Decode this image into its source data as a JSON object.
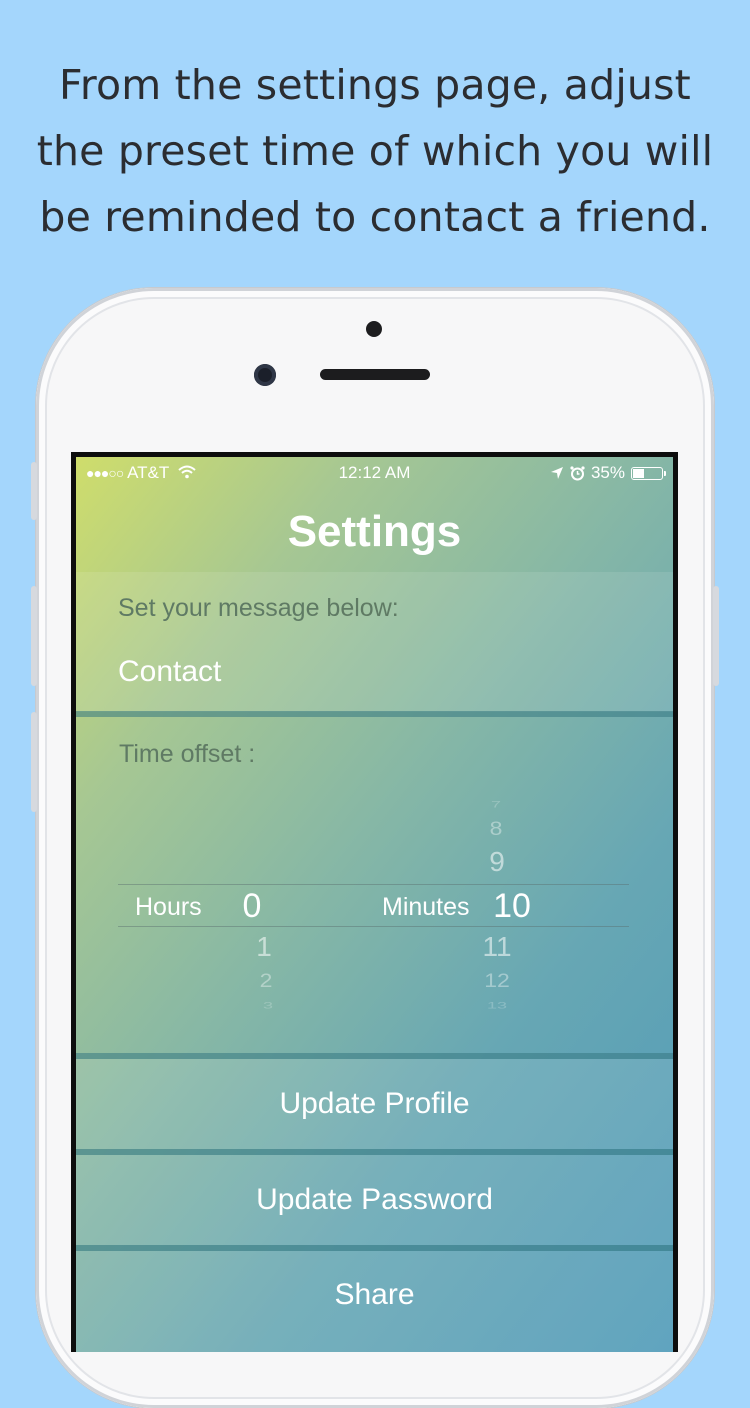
{
  "caption": {
    "line1": "From the settings page, adjust",
    "line2": "the preset time of which you will",
    "line3": "be reminded to contact a friend."
  },
  "status_bar": {
    "signal": "●●●○○",
    "carrier": "AT&T",
    "time": "12:12 AM",
    "battery": "35%",
    "icons": [
      "wifi-icon",
      "location-arrow-icon",
      "alarm-icon",
      "battery-icon"
    ]
  },
  "page": {
    "title": "Settings"
  },
  "message": {
    "label": "Set your message below:",
    "value": "Contact"
  },
  "time_offset": {
    "label": "Time offset :",
    "hours": {
      "unit": "Hours",
      "selected": "0",
      "below": [
        "1",
        "2",
        "3"
      ]
    },
    "minutes": {
      "unit": "Minutes",
      "above": [
        "7",
        "8",
        "9"
      ],
      "selected": "10",
      "below": [
        "11",
        "12",
        "13"
      ]
    }
  },
  "actions": {
    "update_profile": "Update Profile",
    "update_password": "Update Password",
    "share": "Share"
  },
  "colors": {
    "background": "#a4d6fc",
    "gradient_start": "#cfdd6b",
    "gradient_end": "#4f9ab8",
    "text_on_screen": "#ffffff"
  }
}
